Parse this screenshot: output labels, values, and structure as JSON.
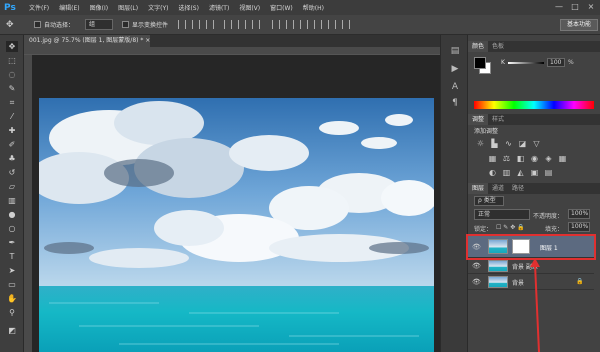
{
  "app": {
    "logo": "Ps"
  },
  "menu": [
    "文件(F)",
    "编辑(E)",
    "图像(I)",
    "图层(L)",
    "文字(Y)",
    "选择(S)",
    "滤镜(T)",
    "视图(V)",
    "窗口(W)",
    "帮助(H)"
  ],
  "window_controls": {
    "minimize": "—",
    "maximize": "□",
    "close": "×"
  },
  "options": {
    "auto_select_label": "自动选择：",
    "auto_select_value": "组",
    "show_transform_label": "显示变换控件",
    "workspace_button": "基本功能"
  },
  "document": {
    "tab_label": "001.jpg @ 75.7% (图层 1, 图层蒙版/8) * ×"
  },
  "panels": {
    "color_tabs": [
      "颜色",
      "色板"
    ],
    "k_label": "K",
    "k_value": "100",
    "k_unit": "%",
    "adjust_tabs": [
      "调整",
      "样式"
    ],
    "adjust_title": "添加调整",
    "layers_tabs": [
      "图层",
      "通道",
      "路径"
    ],
    "kind_label": "ρ 类型",
    "blend_mode": "正常",
    "opacity_label": "不透明度：",
    "opacity_value": "100%",
    "lock_label": "锁定：",
    "fill_label": "填充：",
    "fill_value": "100%",
    "layers": [
      {
        "name": "图层 1",
        "selected": true
      },
      {
        "name": "背景 副本",
        "selected": false
      },
      {
        "name": "背景",
        "selected": false
      }
    ]
  },
  "colors": {
    "highlight": "#e03030",
    "selected_layer": "#5c6a80",
    "sky": "#5b8fc4",
    "sea": "#19b8c8"
  }
}
